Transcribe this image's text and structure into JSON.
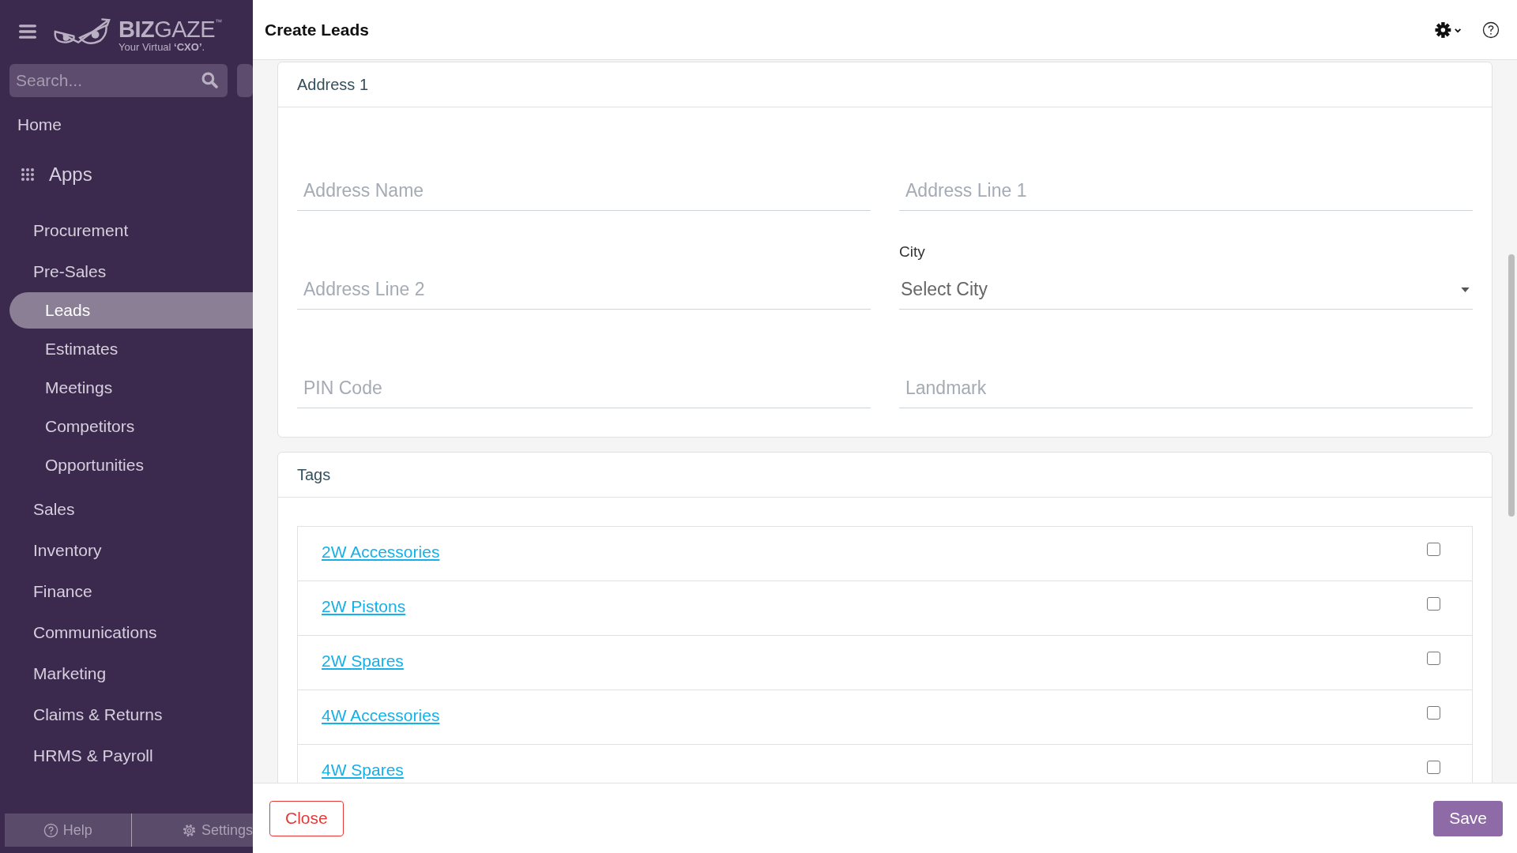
{
  "logo": {
    "wordmark": "**BIZ**GAZE$^{™}$",
    "tagline": "Your Virtual **‘CXO’**."
  },
  "sidebar": {
    "search": {
      "placeholder": "Search..."
    },
    "home": "Home",
    "apps_label": "Apps",
    "items": [
      {
        "label": "Procurement",
        "selected": false
      },
      {
        "label": "Pre-Sales",
        "selected": false,
        "children": [
          {
            "label": "Leads",
            "selected": true
          },
          {
            "label": "Estimates",
            "selected": false
          },
          {
            "label": "Meetings",
            "selected": false
          },
          {
            "label": "Competitors",
            "selected": false
          },
          {
            "label": "Opportunities",
            "selected": false
          }
        ]
      },
      {
        "label": "Sales",
        "selected": false
      },
      {
        "label": "Inventory",
        "selected": false
      },
      {
        "label": "Finance",
        "selected": false
      },
      {
        "label": "Communications",
        "selected": false
      },
      {
        "label": "Marketing",
        "selected": false
      },
      {
        "label": "Claims & Returns",
        "selected": false
      },
      {
        "label": "HRMS & Payroll",
        "selected": false
      }
    ],
    "footer": [
      {
        "kind": "help",
        "label": "Help"
      },
      {
        "kind": "settings",
        "label": "Settings"
      }
    ]
  },
  "header": {
    "title": "Create Leads"
  },
  "address_card": {
    "title": "Address 1",
    "rows": [
      [
        {
          "kind": "text",
          "placeholder": "Address Name"
        },
        {
          "kind": "text",
          "placeholder": "Address Line 1"
        }
      ],
      [
        {
          "kind": "text",
          "placeholder": "Address Line 2"
        },
        {
          "kind": "select",
          "label": "City",
          "placeholder": "Select City"
        }
      ],
      [
        {
          "kind": "text",
          "placeholder": "PIN Code"
        },
        {
          "kind": "text",
          "placeholder": "Landmark"
        }
      ]
    ]
  },
  "tags_card": {
    "title": "Tags",
    "tags": [
      {
        "label": "2W Accessories",
        "checked": false
      },
      {
        "label": "2W Pistons",
        "checked": false
      },
      {
        "label": "2W Spares",
        "checked": false
      },
      {
        "label": "4W Accessories",
        "checked": false
      },
      {
        "label": "4W Spares",
        "checked": false
      }
    ]
  },
  "footer": {
    "close": "Close",
    "save": "Save"
  }
}
